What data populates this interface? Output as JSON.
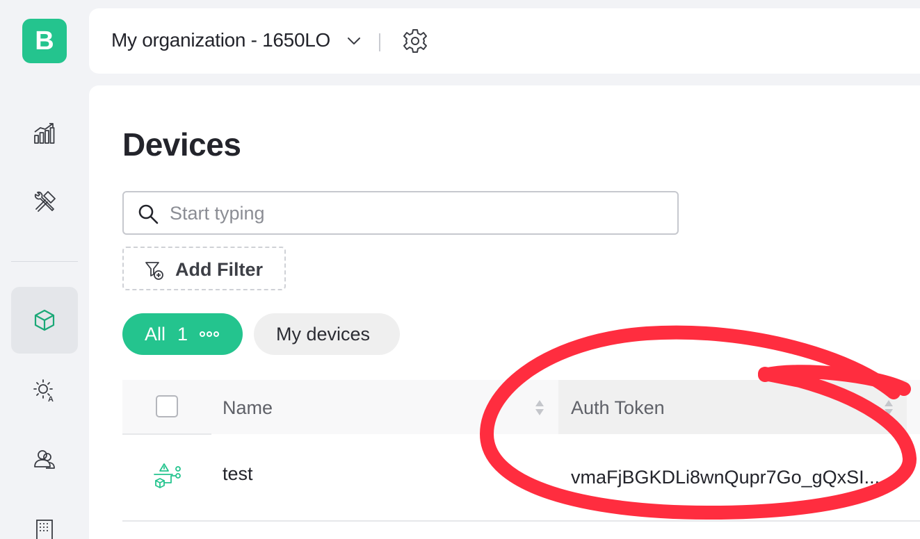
{
  "app": {
    "logo_letter": "B",
    "brand_color": "#24c48e"
  },
  "sidebar": {
    "items": [
      {
        "name": "analytics",
        "icon": "chart-bars-icon",
        "active": false
      },
      {
        "name": "developer-tools",
        "icon": "tools-icon",
        "active": false
      },
      {
        "name": "devices",
        "icon": "cube-icon",
        "active": true
      },
      {
        "name": "automations",
        "icon": "sun-automation-icon",
        "active": false
      },
      {
        "name": "users",
        "icon": "users-icon",
        "active": false
      },
      {
        "name": "organizations",
        "icon": "building-icon",
        "active": false
      }
    ]
  },
  "header": {
    "org_name": "My organization - 1650LO",
    "org_dropdown_icon": "chevron-down-icon",
    "settings_icon": "gear-icon"
  },
  "main": {
    "title": "Devices",
    "search": {
      "placeholder": "Start typing",
      "value": ""
    },
    "add_filter_label": "Add Filter",
    "tabs": [
      {
        "label": "All",
        "count": "1",
        "active": true
      },
      {
        "label": "My devices",
        "active": false
      }
    ],
    "table": {
      "columns": [
        "Name",
        "Auth Token"
      ],
      "rows": [
        {
          "icon": "device-template-icon",
          "name": "test",
          "auth_token": "vmaFjBGKDLi8wnQupr7Go_gQxSI..."
        }
      ]
    }
  },
  "annotation": {
    "shape": "freehand-circle",
    "target": "Auth Token column",
    "color": "#ff2d3f"
  }
}
